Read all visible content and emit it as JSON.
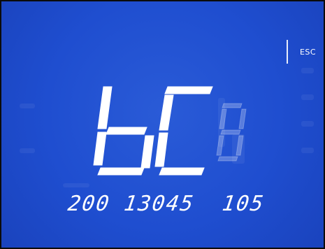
{
  "display": {
    "main_code": "bC",
    "secondary_digit": "8",
    "bottom_line": "200 13045  105",
    "esc_label": "ESC"
  },
  "colors": {
    "lcd_background": "#1f4ed0",
    "segment_on": "#ffffff"
  },
  "icons": {
    "esc": "esc-button"
  }
}
